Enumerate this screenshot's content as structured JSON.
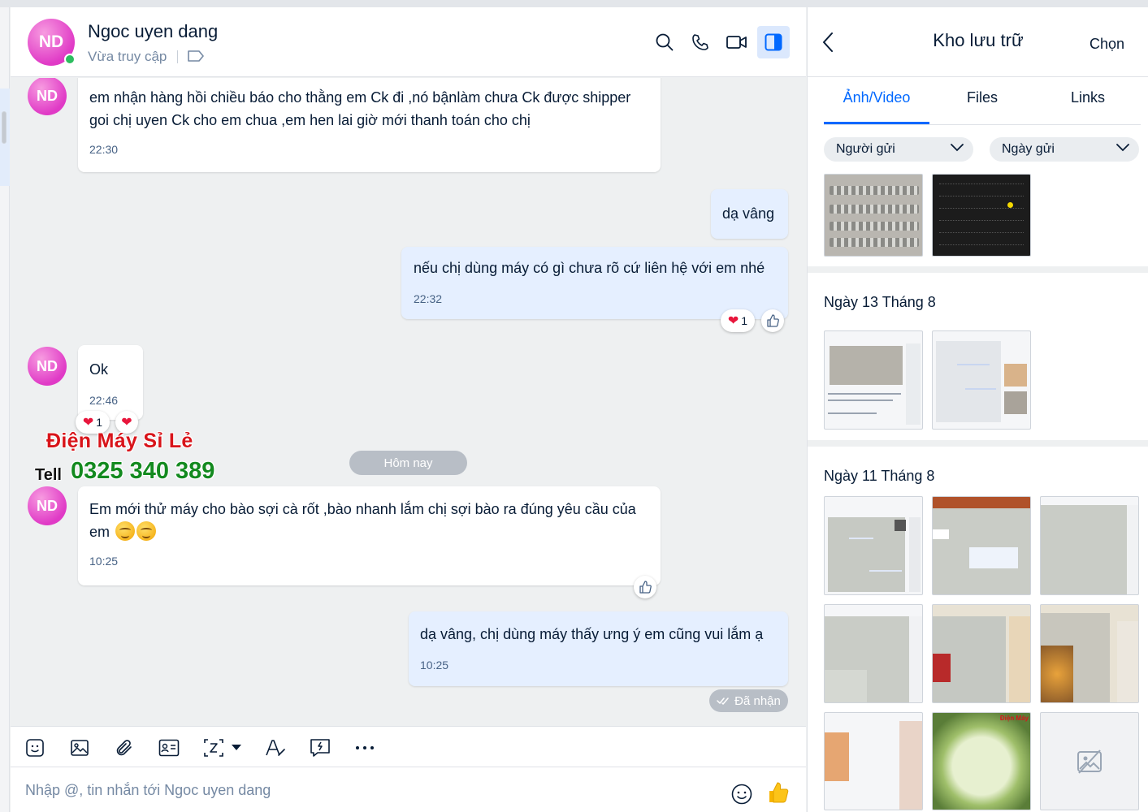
{
  "header": {
    "avatar_initials": "ND",
    "contact_name": "Ngoc uyen dang",
    "status": "Vừa truy cập",
    "icons": [
      "search-icon",
      "phone-icon",
      "video-call-icon",
      "toggle-panel-icon"
    ]
  },
  "messages": [
    {
      "direction": "in",
      "avatar": "ND",
      "text": "em nhận hàng hồi chiều báo cho thằng em Ck đi ,nó bậnlàm chưa Ck được shipper goi chị uyen Ck cho em chua ,em hen lai giờ mới thanh toán cho chị",
      "time": "22:30"
    },
    {
      "direction": "out",
      "text": "dạ vâng"
    },
    {
      "direction": "out",
      "text": "nếu chị dùng máy có gì chưa rõ cứ liên hệ với em nhé",
      "time": "22:32",
      "reaction_count": "1"
    },
    {
      "direction": "in",
      "avatar": "ND",
      "text": "Ok",
      "time": "22:46",
      "reaction_count": "1"
    },
    {
      "direction": "in",
      "avatar": "ND",
      "text": "Em mới thử máy cho bào sợi cà rốt ,bào nhanh lắm chị sợi bào ra đúng yêu cầu của em",
      "time": "10:25"
    },
    {
      "direction": "out",
      "text": "dạ vâng, chị dùng máy thấy ưng ý em cũng vui lắm ạ",
      "time": "10:25"
    }
  ],
  "day_separator": "Hôm nay",
  "seen_status": "Đã nhận",
  "watermark": {
    "title": "Điện Máy Sỉ Lẻ",
    "tell": "Tell",
    "phone": "0325 340 389"
  },
  "composer": {
    "placeholder": "Nhập @, tin nhắn tới Ngoc uyen dang"
  },
  "toolbar": {
    "icons": [
      "sticker-icon",
      "image-icon",
      "attachment-icon",
      "contact-card-icon",
      "screenshot-icon",
      "text-format-icon",
      "quick-message-icon",
      "more-icon"
    ]
  },
  "storage": {
    "title": "Kho lưu trữ",
    "choose_label": "Chọn",
    "tabs": [
      "Ảnh/Video",
      "Files",
      "Links"
    ],
    "active_tab": "Ảnh/Video",
    "filters": [
      "Người gửi",
      "Ngày gửi"
    ],
    "sections": [
      {
        "title": "",
        "thumbnails": 2
      },
      {
        "title": "Ngày 13 Tháng 8",
        "thumbnails": 2
      },
      {
        "title": "Ngày 11 Tháng 8",
        "thumbnails": 9
      }
    ]
  },
  "colors": {
    "accent": "#0068ff",
    "outgoing_bubble": "#e5efff",
    "avatar": "#e03ac6",
    "watermark_red": "#d8141a",
    "watermark_green": "#138a1f"
  }
}
